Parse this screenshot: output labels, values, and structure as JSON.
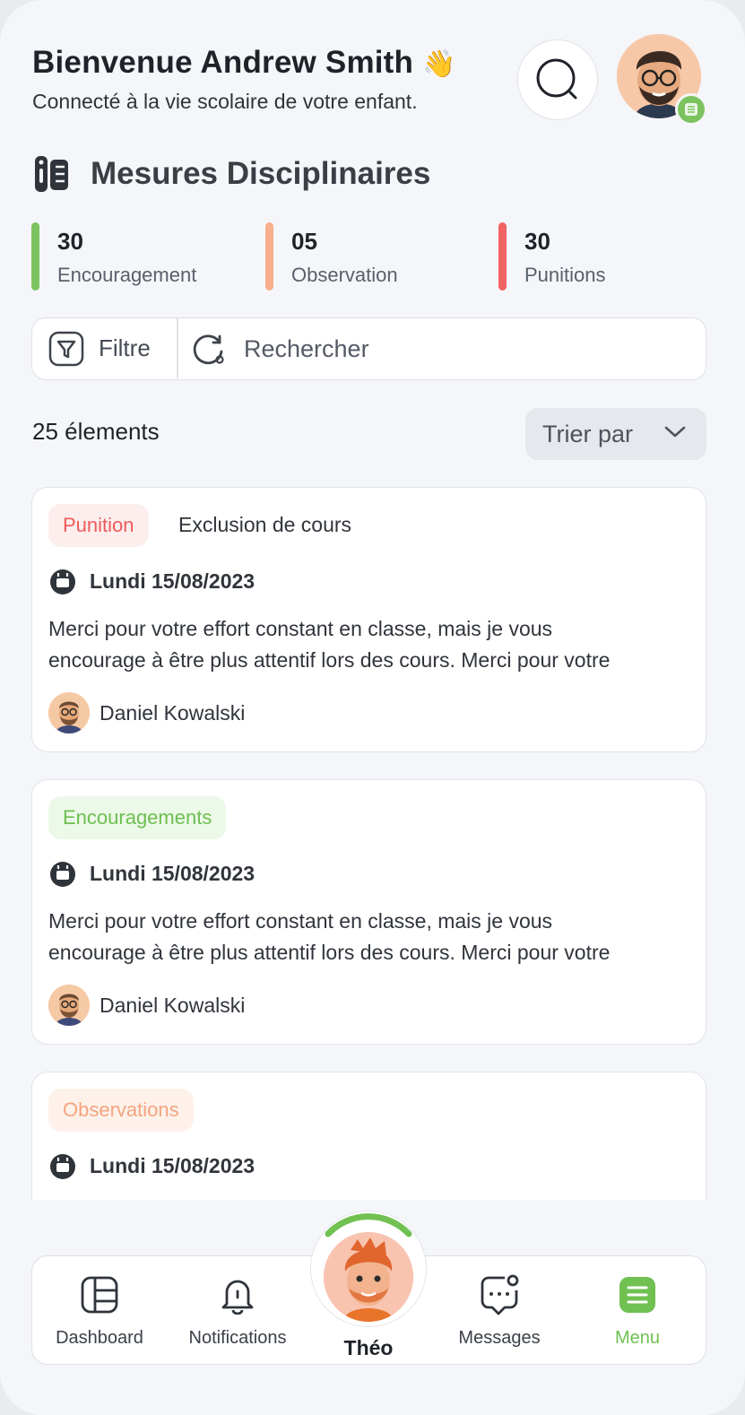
{
  "header": {
    "greeting": "Bienvenue Andrew Smith",
    "wave_emoji": "👋",
    "subtitle": "Connecté à la vie scolaire de votre enfant."
  },
  "section": {
    "title": "Mesures Disciplinaires"
  },
  "stats": [
    {
      "value": "30",
      "label": "Encouragement",
      "color": "#7cc35f"
    },
    {
      "value": "05",
      "label": "Observation",
      "color": "#f9ae8c"
    },
    {
      "value": "30",
      "label": "Punitions",
      "color": "#f26363"
    }
  ],
  "toolbar": {
    "filter_label": "Filtre",
    "search_placeholder": "Rechercher"
  },
  "list": {
    "count_label": "25 élements",
    "sort_label": "Trier par"
  },
  "cards": [
    {
      "tag": "Punition",
      "subtitle": "Exclusion de cours",
      "date": "Lundi 15/08/2023",
      "body_line1": "Merci pour votre effort constant en classe, mais je vous",
      "body_line2": "encourage à être plus attentif lors des cours. Merci pour votre",
      "author": "Daniel Kowalski"
    },
    {
      "tag": "Encouragements",
      "date": "Lundi 15/08/2023",
      "body_line1": "Merci pour votre effort constant en classe, mais je vous",
      "body_line2": "encourage à être plus attentif lors des cours. Merci pour votre",
      "author": "Daniel Kowalski"
    },
    {
      "tag": "Observations",
      "date": "Lundi 15/08/2023"
    }
  ],
  "nav": {
    "dashboard": "Dashboard",
    "notifications": "Notifications",
    "child": "Théo",
    "messages": "Messages",
    "menu": "Menu"
  },
  "colors": {
    "accent_green": "#70c152",
    "punition_red": "#ef5a5a",
    "observation_orange": "#f5a47f"
  }
}
